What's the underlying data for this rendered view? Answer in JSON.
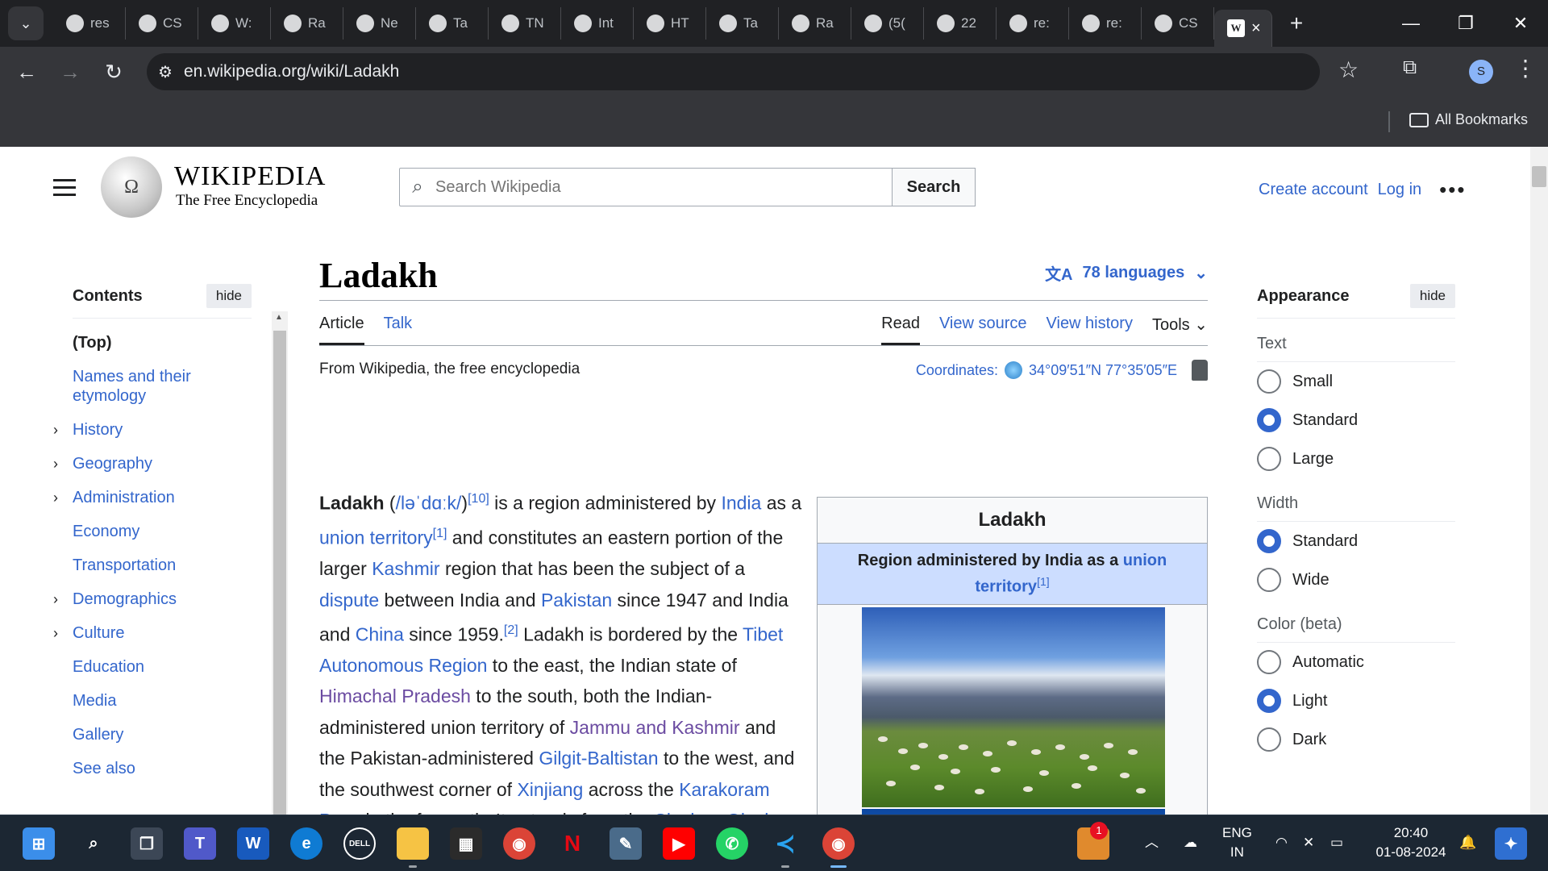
{
  "browser": {
    "tabs": [
      {
        "label": "res",
        "favicon": "globe-icon"
      },
      {
        "label": "CS",
        "favicon": "wiki-green-icon"
      },
      {
        "label": "W:",
        "favicon": "wiki-green-icon"
      },
      {
        "label": "Ra",
        "favicon": "globe-icon"
      },
      {
        "label": "Ne",
        "favicon": "globe-icon"
      },
      {
        "label": "Ta",
        "favicon": "globe-icon"
      },
      {
        "label": "TN",
        "favicon": "globe-icon"
      },
      {
        "label": "Int",
        "favicon": "openai-icon"
      },
      {
        "label": "HT",
        "favicon": "openai-icon"
      },
      {
        "label": "Ta",
        "favicon": "globe-icon"
      },
      {
        "label": "Ra",
        "favicon": "globe-icon"
      },
      {
        "label": "(5(",
        "favicon": "whatsapp-icon"
      },
      {
        "label": "22",
        "favicon": "github-icon"
      },
      {
        "label": "re:",
        "favicon": "globe-icon"
      },
      {
        "label": "re:",
        "favicon": "globe-icon"
      },
      {
        "label": "CS",
        "favicon": "globe-icon"
      }
    ],
    "active_tab_glyph": "W",
    "url": "en.wikipedia.org/wiki/Ladakh",
    "all_bookmarks": "All Bookmarks",
    "profile_initial": "S"
  },
  "wiki": {
    "wordmark": "WIKIPEDIA",
    "tagline": "The Free Encyclopedia",
    "search_placeholder": "Search Wikipedia",
    "search_button": "Search",
    "create_account": "Create account",
    "log_in": "Log in"
  },
  "toc": {
    "title": "Contents",
    "hide": "hide",
    "items": [
      {
        "label": "(Top)",
        "expandable": false
      },
      {
        "label": "Names and their etymology",
        "expandable": false
      },
      {
        "label": "History",
        "expandable": true
      },
      {
        "label": "Geography",
        "expandable": true
      },
      {
        "label": "Administration",
        "expandable": true
      },
      {
        "label": "Economy",
        "expandable": false
      },
      {
        "label": "Transportation",
        "expandable": false
      },
      {
        "label": "Demographics",
        "expandable": true
      },
      {
        "label": "Culture",
        "expandable": true
      },
      {
        "label": "Education",
        "expandable": false
      },
      {
        "label": "Media",
        "expandable": false
      },
      {
        "label": "Gallery",
        "expandable": false
      },
      {
        "label": "See also",
        "expandable": false
      }
    ]
  },
  "article": {
    "title": "Ladakh",
    "languages": "78 languages",
    "tab_article": "Article",
    "tab_talk": "Talk",
    "tab_read": "Read",
    "tab_view_source": "View source",
    "tab_view_history": "View history",
    "tab_tools": "Tools",
    "from": "From Wikipedia, the free encyclopedia",
    "coordinates_label": "Coordinates:",
    "coordinates_value": "34°09′51″N 77°35′05″E",
    "infobox_title": "Ladakh",
    "infobox_sub_text": "Region administered by India as a ",
    "infobox_sub_link": "union territory",
    "infobox_sub_ref": "[1]"
  },
  "appearance": {
    "title": "Appearance",
    "hide": "hide",
    "text_label": "Text",
    "text_options": [
      "Small",
      "Standard",
      "Large"
    ],
    "text_selected": "Standard",
    "width_label": "Width",
    "width_options": [
      "Standard",
      "Wide"
    ],
    "width_selected": "Standard",
    "color_label": "Color (beta)",
    "color_options": [
      "Automatic",
      "Light",
      "Dark"
    ],
    "color_selected": "Light"
  },
  "taskbar": {
    "lang": "ENG",
    "region": "IN",
    "time": "20:40",
    "date": "01-08-2024",
    "notification_count": "1"
  },
  "colors": {
    "link": "#3366cc",
    "visited_link": "#6b4ba1",
    "chrome_dark": "#202124",
    "infobox_header": "#ccddff"
  }
}
